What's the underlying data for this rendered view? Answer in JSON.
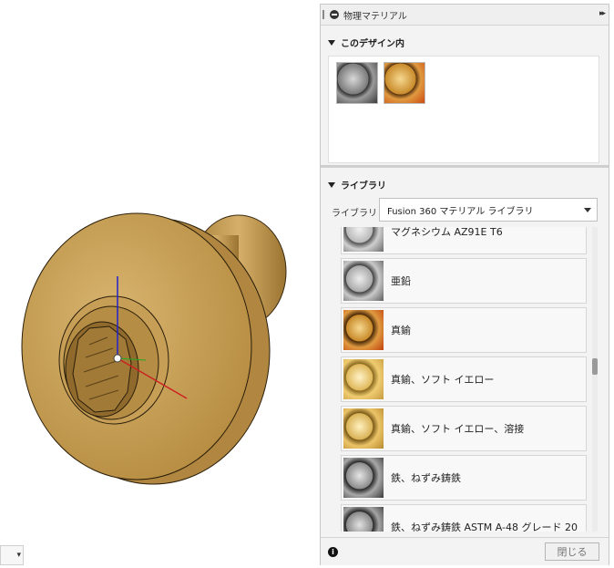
{
  "panel": {
    "title": "物理マテリアル",
    "expand_glyph": "▸▸"
  },
  "design_section": {
    "heading": "このデザイン内",
    "materials": [
      {
        "icon": "steel-ball-icon",
        "color": "#8a8a8a"
      },
      {
        "icon": "brass-ball-icon",
        "color": "#c98a2a"
      }
    ]
  },
  "library_section": {
    "heading": "ライブラリ",
    "library_label": "ライブラリ",
    "library_value": "Fusion 360 マテリアル ライブラリ",
    "items": [
      {
        "label": "マグネシウム AZ91E T6",
        "color": "#b9b9b9"
      },
      {
        "label": "亜鉛",
        "color": "#a9a9a9"
      },
      {
        "label": "真鍮",
        "color": "#c98a2a"
      },
      {
        "label": "真鍮、ソフト イエロー",
        "color": "#e0b85a"
      },
      {
        "label": "真鍮、ソフト イエロー、溶接",
        "color": "#d9b255"
      },
      {
        "label": "鉄、ねずみ鋳鉄",
        "color": "#8c8c8c"
      },
      {
        "label": "鉄、ねずみ鋳鉄 ASTM A-48 グレード 20",
        "color": "#8a8a8a"
      }
    ]
  },
  "footer": {
    "info_glyph": "i",
    "close_label": "閉じる"
  },
  "viewport": {
    "part_color": "#c8a055",
    "nav_glyph": "▾"
  }
}
